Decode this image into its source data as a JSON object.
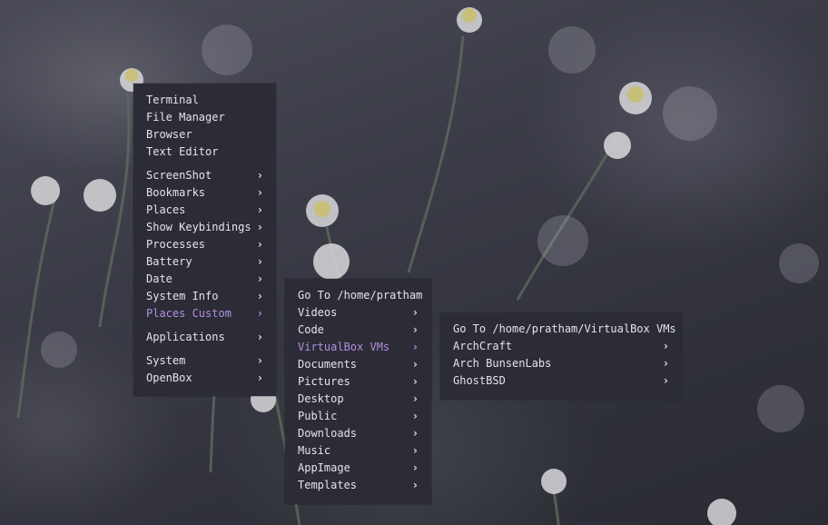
{
  "colors": {
    "menu_bg": "#2b2c36",
    "menu_text": "#e4e4ea",
    "active_text": "#b390e0"
  },
  "arrow_glyph": "›",
  "menus": {
    "root": {
      "items": [
        {
          "label": "Terminal",
          "has_submenu": false
        },
        {
          "label": "File Manager",
          "has_submenu": false
        },
        {
          "label": "Browser",
          "has_submenu": false
        },
        {
          "label": "Text Editor",
          "has_submenu": false
        },
        {
          "label": "ScreenShot",
          "has_submenu": true
        },
        {
          "label": "Bookmarks",
          "has_submenu": true
        },
        {
          "label": "Places",
          "has_submenu": true
        },
        {
          "label": "Show Keybindings",
          "has_submenu": true
        },
        {
          "label": "Processes",
          "has_submenu": true
        },
        {
          "label": "Battery",
          "has_submenu": true
        },
        {
          "label": "Date",
          "has_submenu": true
        },
        {
          "label": "System Info",
          "has_submenu": true
        },
        {
          "label": "Places Custom",
          "has_submenu": true,
          "active": true
        },
        {
          "label": "Applications",
          "has_submenu": true
        },
        {
          "label": "System",
          "has_submenu": true
        },
        {
          "label": "OpenBox",
          "has_submenu": true
        }
      ]
    },
    "places_custom": {
      "items": [
        {
          "label": "Go To /home/pratham",
          "has_submenu": false
        },
        {
          "label": "Videos",
          "has_submenu": true
        },
        {
          "label": "Code",
          "has_submenu": true
        },
        {
          "label": "VirtualBox VMs",
          "has_submenu": true,
          "active": true
        },
        {
          "label": "Documents",
          "has_submenu": true
        },
        {
          "label": "Pictures",
          "has_submenu": true
        },
        {
          "label": "Desktop",
          "has_submenu": true
        },
        {
          "label": "Public",
          "has_submenu": true
        },
        {
          "label": "Downloads",
          "has_submenu": true
        },
        {
          "label": "Music",
          "has_submenu": true
        },
        {
          "label": "AppImage",
          "has_submenu": true
        },
        {
          "label": "Templates",
          "has_submenu": true
        }
      ]
    },
    "virtualbox_vms": {
      "items": [
        {
          "label": "Go To /home/pratham/VirtualBox VMs",
          "has_submenu": false
        },
        {
          "label": "ArchCraft",
          "has_submenu": true
        },
        {
          "label": "Arch BunsenLabs",
          "has_submenu": true
        },
        {
          "label": "GhostBSD",
          "has_submenu": true
        }
      ]
    }
  }
}
